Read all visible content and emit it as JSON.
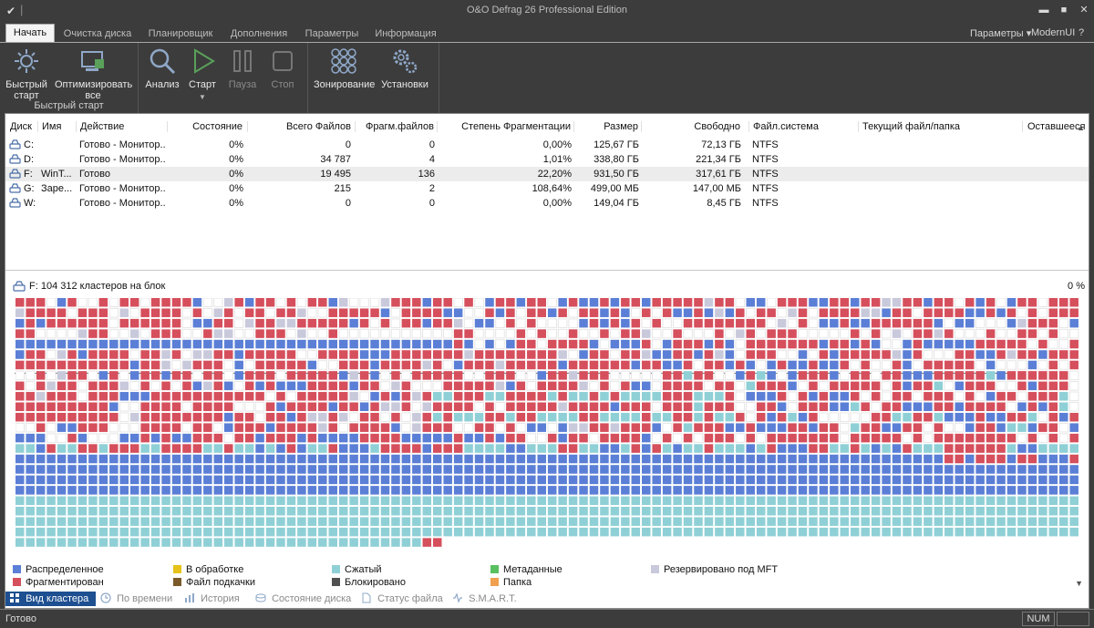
{
  "window": {
    "title": "O&O Defrag 26 Professional Edition"
  },
  "tabs": [
    {
      "label": "Начать",
      "active": true
    },
    {
      "label": "Очистка диска"
    },
    {
      "label": "Планировщик"
    },
    {
      "label": "Дополнения"
    },
    {
      "label": "Параметры"
    },
    {
      "label": "Информация"
    }
  ],
  "tab_right": {
    "params": "Параметры ▾",
    "theme": "ModernUI",
    "help": "?"
  },
  "ribbon": {
    "quick_start": "Быстрый старт",
    "optimize_all": "Оптимизировать все",
    "group_quick": "Быстрый старт",
    "analyze": "Анализ",
    "start": "Старт",
    "pause": "Пауза",
    "stop": "Стоп",
    "zoning": "Зонирование",
    "settings": "Установки"
  },
  "table": {
    "columns": [
      "Диск",
      "Имя",
      "Действие",
      "Состояние",
      "Всего Файлов",
      "Фрагм.файлов",
      "Степень Фрагментации",
      "Размер",
      "Свободно",
      "Файл.система",
      "Текущий файл/папка",
      "Оставшееся вр"
    ],
    "rows": [
      {
        "disk": "C:",
        "name": "",
        "action": "Готово - Монитор...",
        "state": "0%",
        "files": "0",
        "frag": "0",
        "degree": "0,00%",
        "size": "125,67 ГБ",
        "free": "72,13 ГБ",
        "fs": "NTFS",
        "selected": false
      },
      {
        "disk": "D:",
        "name": "",
        "action": "Готово - Монитор...",
        "state": "0%",
        "files": "34 787",
        "frag": "4",
        "degree": "1,01%",
        "size": "338,80 ГБ",
        "free": "221,34 ГБ",
        "fs": "NTFS",
        "selected": false
      },
      {
        "disk": "F:",
        "name": "WinT...",
        "action": "Готово",
        "state": "0%",
        "files": "19 495",
        "frag": "136",
        "degree": "22,20%",
        "size": "931,50 ГБ",
        "free": "317,61 ГБ",
        "fs": "NTFS",
        "selected": true
      },
      {
        "disk": "G:",
        "name": "Заре...",
        "action": "Готово - Монитор...",
        "state": "0%",
        "files": "215",
        "frag": "2",
        "degree": "108,64%",
        "size": "499,00 МБ",
        "free": "147,00 МБ",
        "fs": "NTFS",
        "selected": false
      },
      {
        "disk": "W:",
        "name": "",
        "action": "Готово - Монитор...",
        "state": "0%",
        "files": "0",
        "frag": "0",
        "degree": "0,00%",
        "size": "149,04 ГБ",
        "free": "8,45 ГБ",
        "fs": "NTFS",
        "selected": false
      }
    ]
  },
  "map": {
    "title": "F: 104 312 кластеров на блок",
    "percent": "0 %"
  },
  "legend": [
    {
      "label": "Распределенное",
      "color": "#5b7fd6"
    },
    {
      "label": "В обработке",
      "color": "#e6c21a"
    },
    {
      "label": "Сжатый",
      "color": "#8fd0d6"
    },
    {
      "label": "Метаданные",
      "color": "#58c060"
    },
    {
      "label": "Резервировано под MFT",
      "color": "#c9c9dc"
    },
    {
      "label": "Фрагментирован",
      "color": "#d64f5c"
    },
    {
      "label": "Файл подкачки",
      "color": "#7a5a2a"
    },
    {
      "label": "Блокировано",
      "color": "#505050"
    },
    {
      "label": "Папка",
      "color": "#f0a050"
    }
  ],
  "view_tabs": [
    {
      "label": "Вид кластера",
      "active": true
    },
    {
      "label": "По времени"
    },
    {
      "label": "История"
    },
    {
      "label": "Состояние диска"
    },
    {
      "label": "Статус файла"
    },
    {
      "label": "S.M.A.R.T."
    }
  ],
  "status": {
    "text": "Готово",
    "num": "NUM"
  }
}
